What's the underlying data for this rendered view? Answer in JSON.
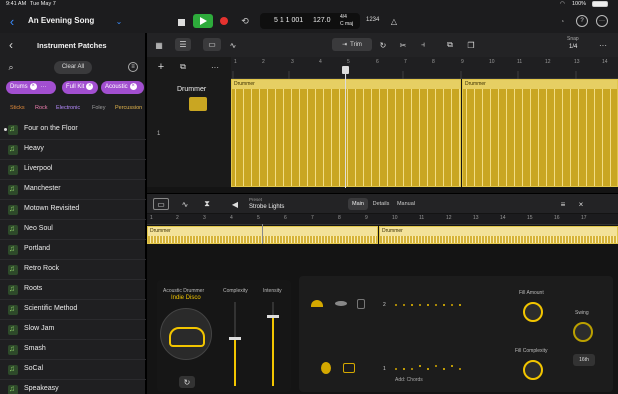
{
  "status": {
    "time": "9:41 AM",
    "date": "Tue May 7",
    "battery": "100%"
  },
  "project": {
    "title": "An Evening Song"
  },
  "transport": {
    "position": "5 1 1 001",
    "tempo": "127.0",
    "signature": "4/4",
    "key": "C maj",
    "count_in": "1234"
  },
  "sidebar": {
    "title": "Instrument Patches",
    "clear_label": "Clear All",
    "filters": [
      "Drums",
      "Full Kit",
      "Acoustic"
    ],
    "tags": [
      {
        "label": "Sticks",
        "color": "#e08a3a"
      },
      {
        "label": "Rock",
        "color": "#f07fb0"
      },
      {
        "label": "Electronic",
        "color": "#b78cff"
      },
      {
        "label": "Foley",
        "color": "#9f9f9f"
      },
      {
        "label": "Percussion",
        "color": "#e2b54c"
      }
    ],
    "items": [
      "Four on the Floor",
      "Heavy",
      "Liverpool",
      "Manchester",
      "Motown Revisited",
      "Neo Soul",
      "Portland",
      "Retro Rock",
      "Roots",
      "Scientific Method",
      "Slow Jam",
      "Smash",
      "SoCal",
      "Speakeasy"
    ]
  },
  "toolbar": {
    "trim_label": "Trim",
    "snap_label": "Snap",
    "snap_value": "1/4"
  },
  "ruler": {
    "bars": [
      "1",
      "2",
      "3",
      "4",
      "5",
      "6",
      "7",
      "8",
      "9",
      "10",
      "11",
      "12",
      "13",
      "14",
      "15",
      "16",
      "17"
    ]
  },
  "track": {
    "name": "Drummer",
    "number": "1",
    "region_label": "Drummer"
  },
  "editor": {
    "preset_label": "Preset",
    "preset_value": "Strobe Lights",
    "tabs": [
      "Main",
      "Details",
      "Manual"
    ],
    "active_tab": "Main",
    "region_label": "Drummer"
  },
  "drummer": {
    "title": "Acoustic Drummer",
    "genre": "Indie Disco",
    "complexity_label": "Complexity",
    "intensity_label": "Intensity",
    "fill_amount_label": "Fill Amount",
    "fill_complexity_label": "Fill Complexity",
    "swing_label": "Swing",
    "swing_value": "16th",
    "add_chords_label": "Add: Chords",
    "lane_numbers": [
      "2",
      "1"
    ]
  },
  "colors": {
    "accent": "#f2c500",
    "region": "#c9a622",
    "purple": "#a24fd0"
  }
}
